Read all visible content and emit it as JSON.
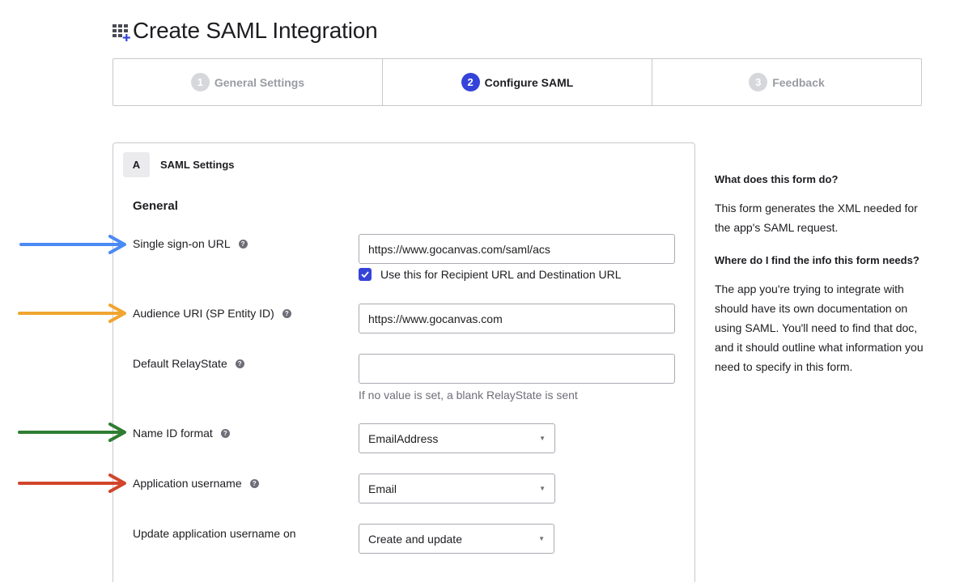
{
  "page": {
    "title": "Create SAML Integration",
    "title_icon": "apps-add-icon"
  },
  "wizard": {
    "steps": [
      {
        "number": "1",
        "label": "General Settings",
        "active": false
      },
      {
        "number": "2",
        "label": "Configure SAML",
        "active": true
      },
      {
        "number": "3",
        "label": "Feedback",
        "active": false
      }
    ],
    "accent_color": "#3543d9"
  },
  "section": {
    "badge": "A",
    "title": "SAML Settings",
    "group_title": "General"
  },
  "fields": {
    "sso_url": {
      "label": "Single sign-on URL",
      "value": "https://www.gocanvas.com/saml/acs"
    },
    "recipient_checkbox": {
      "label": "Use this for Recipient URL and Destination URL",
      "checked": true
    },
    "audience_uri": {
      "label": "Audience URI (SP Entity ID)",
      "value": "https://www.gocanvas.com"
    },
    "relay_state": {
      "label": "Default RelayState",
      "value": "",
      "hint": "If no value is set, a blank RelayState is sent"
    },
    "name_id_format": {
      "label": "Name ID format",
      "value": "EmailAddress"
    },
    "app_username": {
      "label": "Application username",
      "value": "Email"
    },
    "update_username_on": {
      "label": "Update application username on",
      "value": "Create and update"
    }
  },
  "sidebar": {
    "q1": "What does this form do?",
    "a1": "This form generates the XML needed for the app's SAML request.",
    "q2": "Where do I find the info this form needs?",
    "a2": "The app you're trying to integrate with should have its own documentation on using SAML. You'll need to find that doc, and it should outline what information you need to specify in this form."
  },
  "annotations": {
    "arrow_colors": [
      "#4a8af4",
      "#f0a530",
      "#2e7d32",
      "#d0452c"
    ]
  }
}
